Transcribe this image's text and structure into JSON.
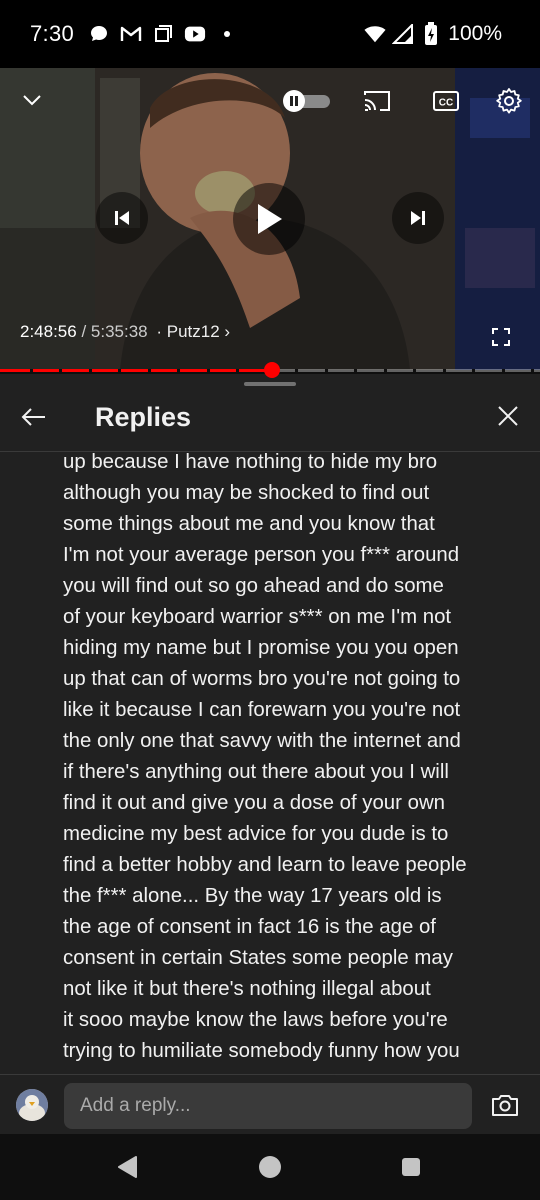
{
  "status_bar": {
    "time": "7:30",
    "battery": "100%",
    "icons": [
      "chat-bubble-icon",
      "gmail-icon",
      "screen-icon",
      "youtube-icon",
      "dot-icon",
      "wifi-icon",
      "signal-icon",
      "battery-icon"
    ]
  },
  "player": {
    "current_time": "2:48:56",
    "separator": " / ",
    "duration": "5:35:38",
    "chapter": " · Putz12 ›",
    "progress_fraction": 0.503,
    "icons": {
      "collapse": "chevron-down-icon",
      "autoplay": "autoplay-toggle-icon",
      "cast": "cast-icon",
      "captions": "cc-icon",
      "settings": "gear-icon",
      "previous": "skip-previous-icon",
      "play": "play-icon",
      "next": "skip-next-icon",
      "fullscreen": "fullscreen-icon"
    },
    "accent_color": "#ff0000"
  },
  "replies_panel": {
    "title": "Replies",
    "reply_text": "up because I have nothing to hide my bro\nalthough you may be shocked to find out\nsome things about me and you know that\nI'm not your average person you f*** around\nyou will find out so go ahead and do some\nof your keyboard warrior s*** on me I'm not\nhiding my name but I promise you you open\nup that can of worms bro you're not going to\nlike it because I can forewarn you you're not\nthe only one that savvy with the internet and\nif there's anything out there about you I will\nfind it out and give you a dose of your own\nmedicine my best advice for you dude is to\nfind a better hobby and learn to leave people\nthe f*** alone... By the way 17 years old is\nthe age of consent in fact 16 is the age of\nconsent in certain States some people may\nnot like it but there's nothing illegal about\nit sooo maybe know the laws before you're\ntrying to humiliate somebody funny how you\nbring up that you all are afraid of his freedom",
    "composer": {
      "placeholder": "Add a reply...",
      "value": ""
    }
  },
  "nav_bar": {
    "icons": [
      "back-triangle-icon",
      "home-circle-icon",
      "recents-square-icon"
    ]
  }
}
